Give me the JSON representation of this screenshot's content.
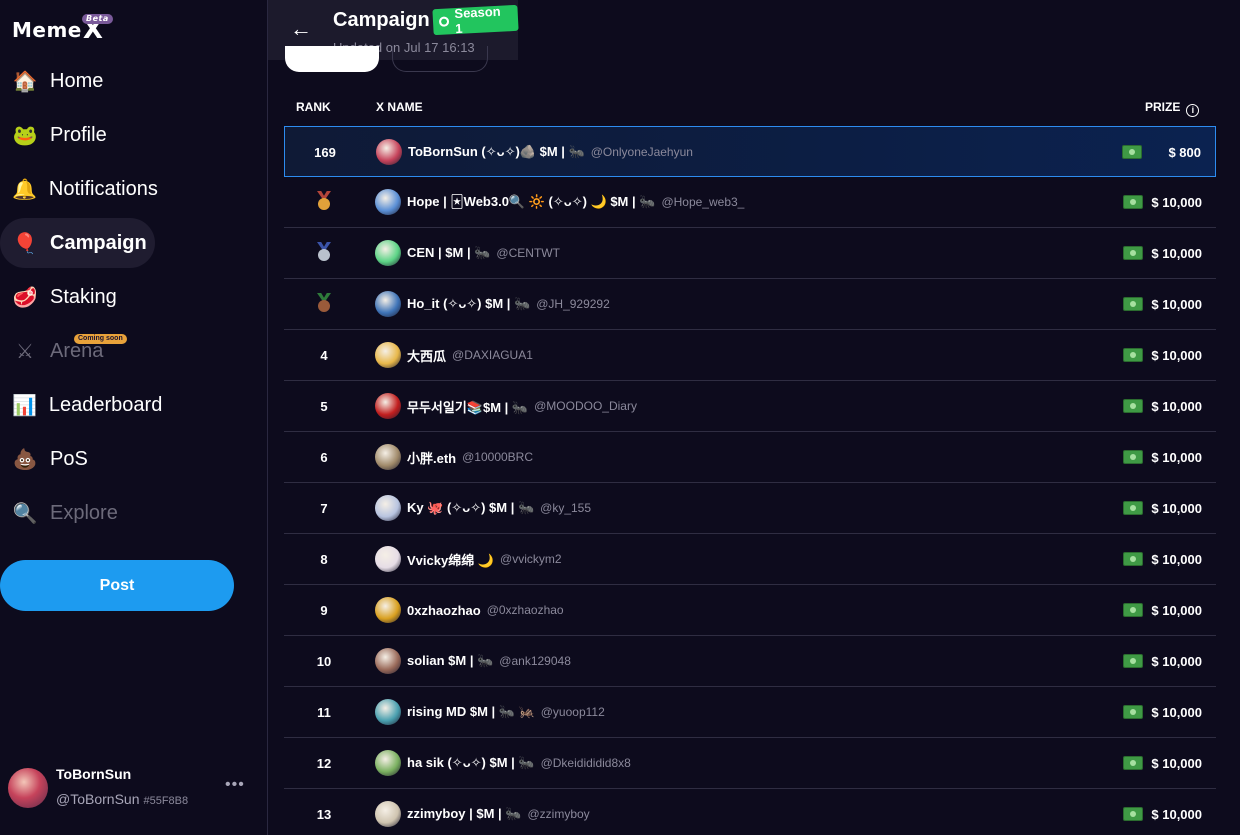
{
  "brand": {
    "name": "Meme",
    "x": "X",
    "beta": "Beta"
  },
  "nav": [
    {
      "label": "Home",
      "icon": "house-icon",
      "glyph": "🏠"
    },
    {
      "label": "Profile",
      "icon": "frog-icon",
      "glyph": "🐸"
    },
    {
      "label": "Notifications",
      "icon": "bell-icon",
      "glyph": "🔔"
    },
    {
      "label": "Campaign",
      "icon": "balloon-icon",
      "glyph": "🎈"
    },
    {
      "label": "Staking",
      "icon": "steak-icon",
      "glyph": "🥩"
    },
    {
      "label": "Arena",
      "icon": "swords-icon",
      "glyph": "⚔",
      "badge": "Coming soon"
    },
    {
      "label": "Leaderboard",
      "icon": "podium-icon",
      "glyph": "📊"
    },
    {
      "label": "PoS",
      "icon": "poop-icon",
      "glyph": "💩"
    },
    {
      "label": "Explore",
      "icon": "magnifier-icon",
      "glyph": "🔍"
    }
  ],
  "post_label": "Post",
  "user": {
    "name": "ToBornSun",
    "handle": "@ToBornSun",
    "code": "#55F8B8",
    "more": "•••"
  },
  "header": {
    "title": "Campaign",
    "badge": "Season 1",
    "updated": "Updated on Jul 17 16:13"
  },
  "table": {
    "headers": {
      "rank": "RANK",
      "name": "X NAME",
      "prize": "PRIZE"
    },
    "rows": [
      {
        "rank": "169",
        "name": "ToBornSun (✧ᴗ✧)🪨 $M | 🐜",
        "handle": "@OnlyoneJaehyun",
        "prize": "$ 800",
        "avatar": "#c6435b"
      },
      {
        "rank": "",
        "medal": "gold",
        "name": "Hope | 🃏Web3.0🔍 🔆 (✧ᴗ✧) 🌙 $M | 🐜",
        "handle": "@Hope_web3_",
        "prize": "$ 10,000",
        "avatar": "#5a8fd6"
      },
      {
        "rank": "",
        "medal": "silver",
        "name": "CEN | $M | 🐜",
        "handle": "@CENTWT",
        "prize": "$ 10,000",
        "avatar": "#5cd486"
      },
      {
        "rank": "",
        "medal": "bronze",
        "name": "Ho_it (✧ᴗ✧) $M | 🐜",
        "handle": "@JH_929292",
        "prize": "$ 10,000",
        "avatar": "#3f74b8"
      },
      {
        "rank": "4",
        "name": "大西瓜",
        "handle": "@DAXIAGUA1",
        "prize": "$ 10,000",
        "avatar": "#e8b84a"
      },
      {
        "rank": "5",
        "name": "무두서일기📚$M | 🐜",
        "handle": "@MOODOO_Diary",
        "prize": "$ 10,000",
        "avatar": "#c21f1f"
      },
      {
        "rank": "6",
        "name": "小胖.eth",
        "handle": "@10000BRC",
        "prize": "$ 10,000",
        "avatar": "#a08a6a"
      },
      {
        "rank": "7",
        "name": "Ky 🐙 (✧ᴗ✧) $M | 🐜",
        "handle": "@ky_155",
        "prize": "$ 10,000",
        "avatar": "#b8c4e0"
      },
      {
        "rank": "8",
        "name": "Vvicky绵绵 🌙",
        "handle": "@vvickym2",
        "prize": "$ 10,000",
        "avatar": "#e6dde6"
      },
      {
        "rank": "9",
        "name": "0xzhaozhao",
        "handle": "@0xzhaozhao",
        "prize": "$ 10,000",
        "avatar": "#d9a020"
      },
      {
        "rank": "10",
        "name": "solian $M | 🐜",
        "handle": "@ank129048",
        "prize": "$ 10,000",
        "avatar": "#9a6a5a"
      },
      {
        "rank": "11",
        "name": "rising MD $M | 🐜 🦗",
        "handle": "@yuoop112",
        "prize": "$ 10,000",
        "avatar": "#4aa0b0"
      },
      {
        "rank": "12",
        "name": "ha sik (✧ᴗ✧) $M | 🐜",
        "handle": "@Dkeidididid8x8",
        "prize": "$ 10,000",
        "avatar": "#7ab060"
      },
      {
        "rank": "13",
        "name": "zzimyboy | $M | 🐜",
        "handle": "@zzimyboy",
        "prize": "$ 10,000",
        "avatar": "#cfc4b0"
      }
    ]
  },
  "colors": {
    "accent": "#1d9bf0",
    "season": "#22c55e",
    "bg": "#0d0b1d"
  }
}
